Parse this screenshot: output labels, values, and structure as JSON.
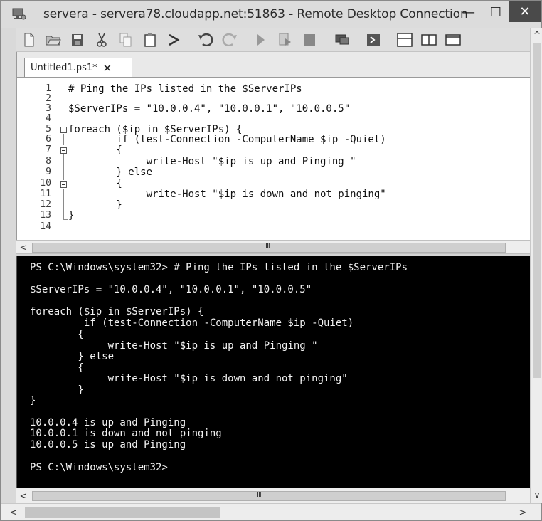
{
  "window": {
    "title": "servera - servera78.cloudapp.net:51863 - Remote Desktop Connection",
    "minimize_glyph": "—",
    "maximize_glyph": "☐",
    "close_glyph": "✕"
  },
  "toolbar": {
    "icons": [
      "new-file-icon",
      "open-folder-icon",
      "save-icon",
      "cut-icon",
      "copy-icon",
      "paste-icon",
      "clear-console-icon",
      "undo-icon",
      "redo-icon",
      "run-script-icon",
      "run-selection-icon",
      "stop-icon",
      "remote-powershell-icon",
      "powershell-console-icon",
      "show-script-pane-top-icon",
      "show-script-pane-right-icon",
      "show-script-pane-max-icon"
    ]
  },
  "tab": {
    "label": "Untitled1.ps1*",
    "close_glyph": "✕"
  },
  "editor": {
    "line_numbers": [
      "1",
      "2",
      "3",
      "4",
      "5",
      "6",
      "7",
      "8",
      "9",
      "10",
      "11",
      "12",
      "13",
      "14"
    ],
    "lines": [
      "# Ping the IPs listed in the $ServerIPs",
      "",
      "$ServerIPs = \"10.0.0.4\", \"10.0.0.1\", \"10.0.0.5\"",
      "",
      "foreach ($ip in $ServerIPs) {",
      "        if (test-Connection -ComputerName $ip -Quiet)",
      "        {",
      "             write-Host \"$ip is up and Pinging \"",
      "        } else",
      "        {",
      "             write-Host \"$ip is down and not pinging\"",
      "        }",
      "}",
      ""
    ],
    "scroll_grip": "III"
  },
  "console": {
    "lines": [
      "PS C:\\Windows\\system32> # Ping the IPs listed in the $ServerIPs",
      "",
      "$ServerIPs = \"10.0.0.4\", \"10.0.0.1\", \"10.0.0.5\"",
      "",
      "foreach ($ip in $ServerIPs) {",
      "         if (test-Connection -ComputerName $ip -Quiet)",
      "        {",
      "             write-Host \"$ip is up and Pinging \"",
      "        } else",
      "        {",
      "             write-Host \"$ip is down and not pinging\"",
      "        }",
      "}",
      "",
      "10.0.0.4 is up and Pinging",
      "10.0.0.1 is down and not pinging",
      "10.0.0.5 is up and Pinging",
      "",
      "PS C:\\Windows\\system32>"
    ],
    "scroll_grip": "III"
  },
  "scrollbars": {
    "left_arrow": "<",
    "right_arrow": ">",
    "up_arrow": "^",
    "down_arrow": "v"
  }
}
